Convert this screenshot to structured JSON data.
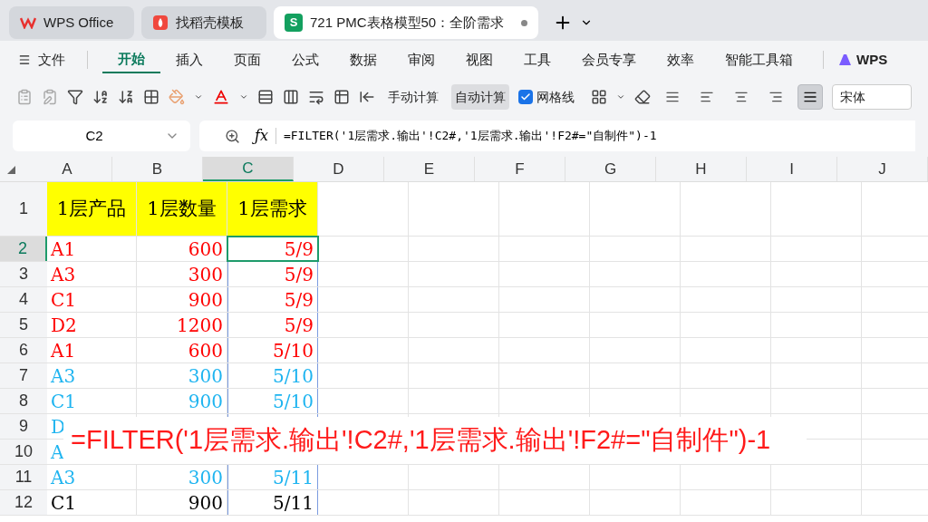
{
  "tabs": [
    {
      "label": "WPS Office",
      "kind": "wps",
      "selected": false
    },
    {
      "label": "找稻壳模板",
      "kind": "docer",
      "selected": false
    },
    {
      "label": "721 PMC表格模型50：全阶需求",
      "kind": "sheet",
      "badge": "S",
      "selected": true,
      "modified": true
    }
  ],
  "menu": {
    "file": "文件",
    "items": [
      {
        "label": "开始",
        "selected": true
      },
      {
        "label": "插入",
        "selected": false
      },
      {
        "label": "页面",
        "selected": false
      },
      {
        "label": "公式",
        "selected": false
      },
      {
        "label": "数据",
        "selected": false
      },
      {
        "label": "审阅",
        "selected": false
      },
      {
        "label": "视图",
        "selected": false
      },
      {
        "label": "工具",
        "selected": false
      },
      {
        "label": "会员专享",
        "selected": false
      },
      {
        "label": "效率",
        "selected": false
      },
      {
        "label": "智能工具箱",
        "selected": false
      }
    ],
    "brand": "WPS"
  },
  "toolbar": {
    "calc_buttons": [
      {
        "label": "手动计算",
        "selected": false
      },
      {
        "label": "自动计算",
        "selected": true
      }
    ],
    "gridlines": {
      "label": "网格线",
      "checked": true
    },
    "align_buttons": [
      {
        "selected": false
      },
      {
        "selected": false
      },
      {
        "selected": false
      },
      {
        "selected": false
      },
      {
        "selected": true
      }
    ],
    "font": "宋体"
  },
  "formula_bar": {
    "cell_ref": "C2",
    "fx_label": "ƒx",
    "formula": "=FILTER('1层需求.输出'!C2#,'1层需求.输出'!F2#=\"自制件\")-1"
  },
  "columns": [
    {
      "label": "A",
      "selected": false
    },
    {
      "label": "B",
      "selected": false
    },
    {
      "label": "C",
      "selected": true
    },
    {
      "label": "D",
      "selected": false
    },
    {
      "label": "E",
      "selected": false
    },
    {
      "label": "F",
      "selected": false
    },
    {
      "label": "G",
      "selected": false
    },
    {
      "label": "H",
      "selected": false
    },
    {
      "label": "I",
      "selected": false
    },
    {
      "label": "J",
      "selected": false
    }
  ],
  "rows": [
    {
      "header": "1",
      "kind": "title",
      "selected": false,
      "cells": [
        "1层产品",
        "1层数量",
        "1层需求"
      ]
    },
    {
      "header": "2",
      "kind": "data",
      "selected": true,
      "color": "#ff0000",
      "cells": [
        "A1",
        "600",
        "5/9"
      ]
    },
    {
      "header": "3",
      "kind": "data",
      "selected": false,
      "color": "#ff0000",
      "cells": [
        "A3",
        "300",
        "5/9"
      ]
    },
    {
      "header": "4",
      "kind": "data",
      "selected": false,
      "color": "#ff0000",
      "cells": [
        "C1",
        "900",
        "5/9"
      ]
    },
    {
      "header": "5",
      "kind": "data",
      "selected": false,
      "color": "#ff0000",
      "cells": [
        "D2",
        "1200",
        "5/9"
      ]
    },
    {
      "header": "6",
      "kind": "data",
      "selected": false,
      "color": "#ff0000",
      "cells": [
        "A1",
        "600",
        "5/10"
      ]
    },
    {
      "header": "7",
      "kind": "data",
      "selected": false,
      "color": "#1eb4f0",
      "cells": [
        "A3",
        "300",
        "5/10"
      ]
    },
    {
      "header": "8",
      "kind": "data",
      "selected": false,
      "color": "#1eb4f0",
      "cells": [
        "C1",
        "900",
        "5/10"
      ]
    },
    {
      "header": "9",
      "kind": "data",
      "selected": false,
      "color": "#1eb4f0",
      "cells": [
        "D"
      ]
    },
    {
      "header": "10",
      "kind": "data",
      "selected": false,
      "color": "#1eb4f0",
      "cells": [
        "A"
      ]
    },
    {
      "header": "11",
      "kind": "data",
      "selected": false,
      "color": "#1eb4f0",
      "cells": [
        "A3",
        "300",
        "5/11"
      ]
    },
    {
      "header": "12",
      "kind": "data",
      "selected": false,
      "color": "#000000",
      "cells": [
        "C1",
        "900",
        "5/11"
      ]
    }
  ],
  "caption": "=FILTER('1层需求.输出'!C2#,'1层需求.输出'!F2#=\"自制件\")-1"
}
